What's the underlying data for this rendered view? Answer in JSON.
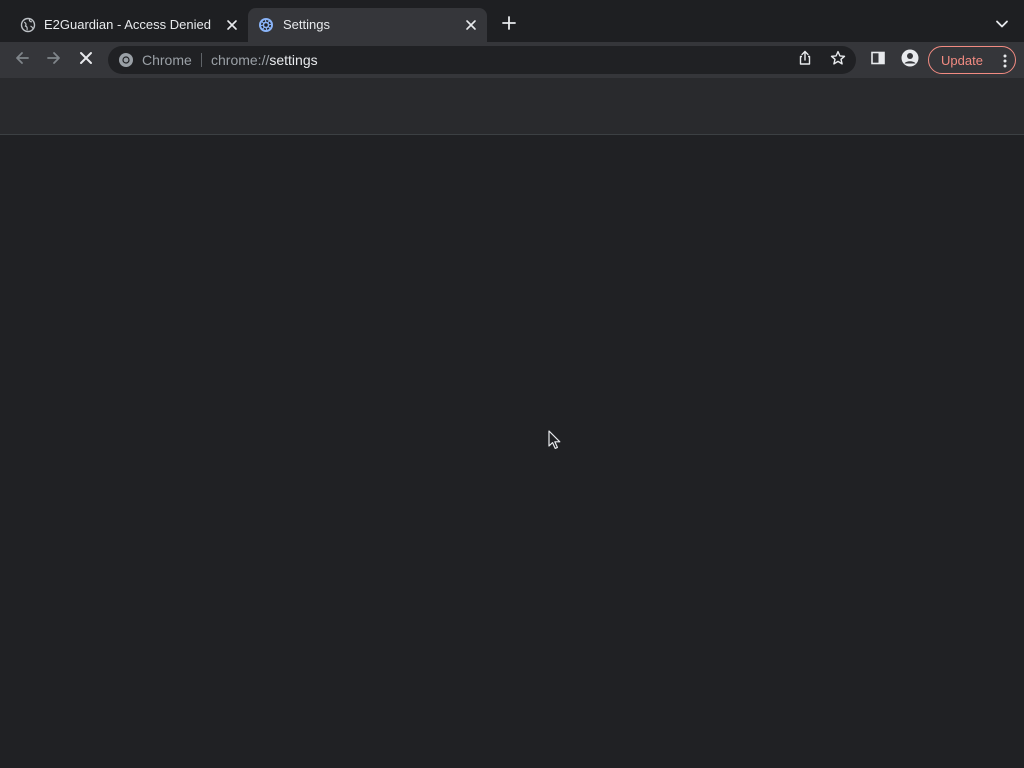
{
  "browser": "Chrome",
  "tabs": [
    {
      "title": "E2Guardian - Access Denied",
      "icon": "globe-icon",
      "active": false
    },
    {
      "title": "Settings",
      "icon": "settings-gear-icon",
      "active": true
    }
  ],
  "toolbar": {
    "back_icon": "arrow-left-icon",
    "forward_icon": "arrow-right-icon",
    "stop_icon": "close-x-icon",
    "chip_label": "Chrome",
    "url_scheme": "chrome://",
    "url_host": "settings",
    "share_icon": "share-icon",
    "bookmark_icon": "star-icon",
    "side_panel_icon": "side-panel-icon",
    "profile_icon": "person-icon",
    "update_label": "Update",
    "menu_icon": "kebab-menu-icon"
  },
  "colors": {
    "page_background": "#202124",
    "toolbar_background": "#35363a",
    "tabstrip_background": "#1e1f22",
    "update_accent": "#f28b82",
    "text_primary": "#e8eaed",
    "text_secondary": "#9aa0a6"
  }
}
